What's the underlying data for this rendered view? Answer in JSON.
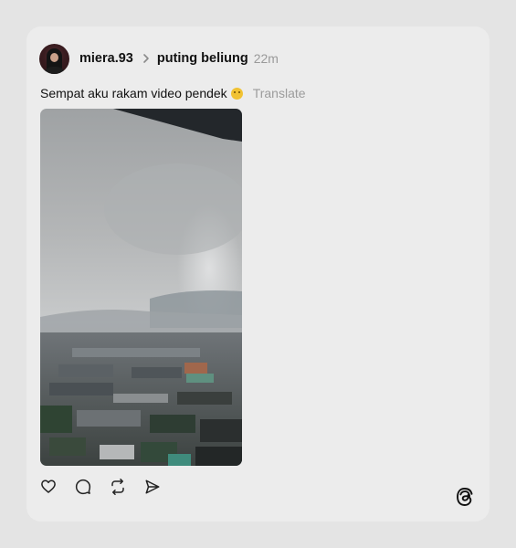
{
  "post": {
    "username": "miera.93",
    "topic": "puting beliung",
    "time": "22m",
    "caption": "Sempat aku rakam video pendek",
    "translate_label": "Translate"
  },
  "icons": {
    "chevron": "chevron-right-icon",
    "emoji": "smiling-face-icon",
    "like": "heart-icon",
    "comment": "comment-icon",
    "repost": "repost-icon",
    "share": "send-icon",
    "brand": "threads-logo-icon"
  },
  "colors": {
    "page_background": "#e4e4e4",
    "card_background": "#ececec",
    "text_primary": "#121212",
    "text_muted": "#9a9a9a"
  }
}
